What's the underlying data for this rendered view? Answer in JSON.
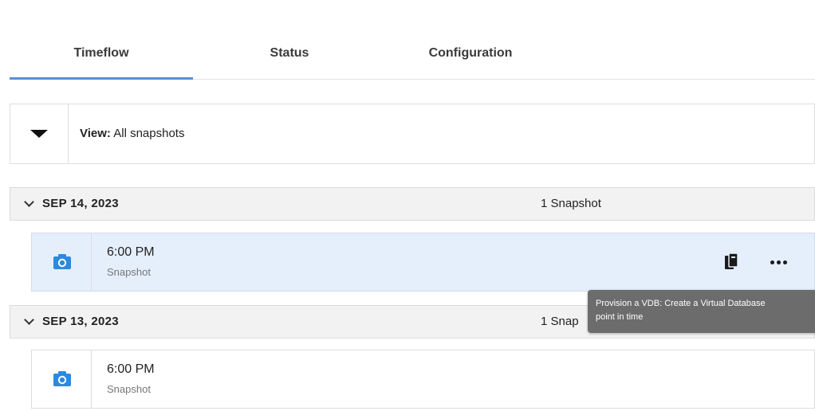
{
  "tabs": {
    "timeflow": "Timeflow",
    "status": "Status",
    "configuration": "Configuration",
    "active": "Timeflow"
  },
  "view_filter": {
    "prefix": "View:",
    "value": "All snapshots"
  },
  "groups": [
    {
      "date": "SEP 14, 2023",
      "count_num": "1",
      "count_label": "Snapshot",
      "snapshots": [
        {
          "time": "6:00 PM",
          "type": "Snapshot",
          "selected": true
        }
      ]
    },
    {
      "date": "SEP 13, 2023",
      "count_num": "1",
      "count_label": "Snap",
      "snapshots": [
        {
          "time": "6:00 PM",
          "type": "Snapshot",
          "selected": false
        }
      ]
    }
  ],
  "tooltip": {
    "line1": "Provision a VDB: Create a Virtual Database",
    "line2": "point in time"
  },
  "icons": {
    "view_toggle": "caret-down-icon",
    "group_toggle": "chevron-down-icon",
    "snapshot": "camera-icon",
    "provision": "provision-vdb-icon",
    "more": "more-horizontal-icon"
  },
  "colors": {
    "accent": "#5b8fd6",
    "camera_blue": "#2b8ae0",
    "selected_row_bg": "#e5eefb",
    "group_header_bg": "#f2f2f2",
    "tooltip_bg": "#6c6c6c"
  }
}
